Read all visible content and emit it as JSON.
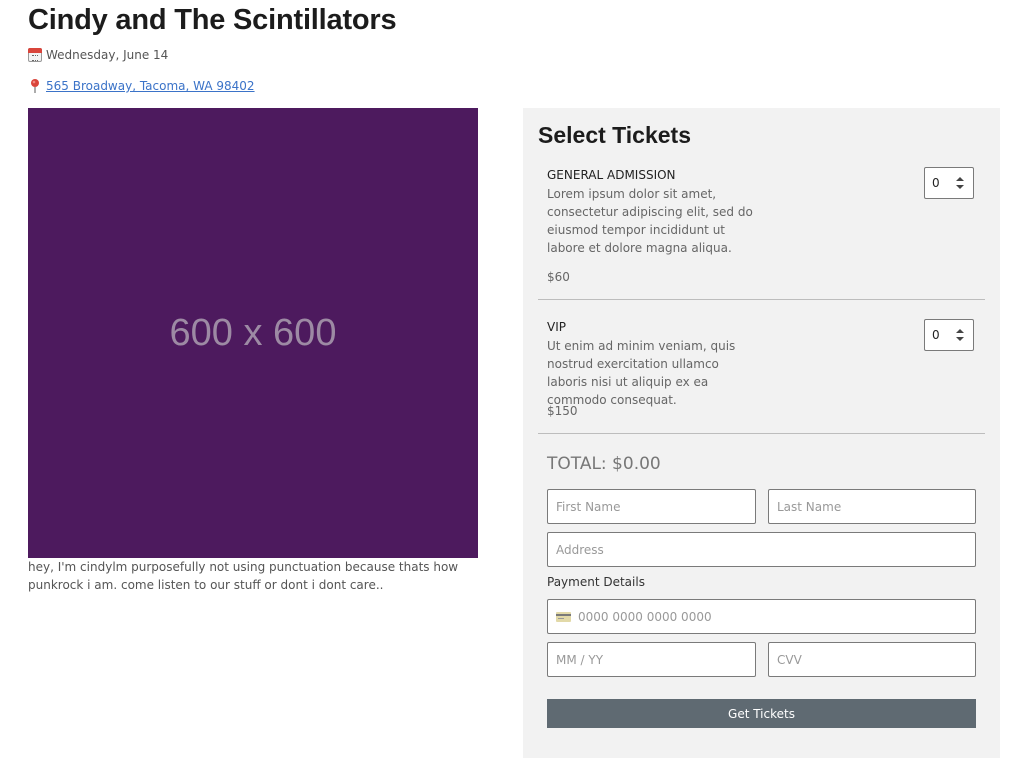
{
  "event": {
    "title": "Cindy and The Scintillators",
    "date": "Wednesday, June 14",
    "address": "565 Broadway, Tacoma, WA 98402",
    "image_label": "600 x 600",
    "image_color": "#4d1a5e",
    "description": "hey, I'm cindylm purposefully not using punctuation because thats how punkrock i am. come listen to our stuff or dont i dont care..",
    "date_icon": "calendar-icon",
    "address_icon": "map-pin-icon"
  },
  "tickets_panel": {
    "title": "Select Tickets",
    "tickets": [
      {
        "name": "GENERAL ADMISSION",
        "description": "Lorem ipsum dolor sit amet, consectetur adipiscing elit, sed do eiusmod tempor incididunt ut labore et dolore magna aliqua.",
        "price": "$60",
        "quantity": "0"
      },
      {
        "name": "VIP",
        "description": "Ut enim ad minim veniam, quis nostrud exercitation ullamco laboris nisi ut aliquip ex ea commodo consequat.",
        "price": "$150",
        "quantity": "0"
      }
    ],
    "total": "TOTAL: $0.00"
  },
  "form": {
    "first_name": {
      "value": "",
      "placeholder": "First Name"
    },
    "last_name": {
      "value": "",
      "placeholder": "Last Name"
    },
    "address": {
      "value": "",
      "placeholder": "Address"
    },
    "payment_label": "Payment Details",
    "card_number": {
      "value": "",
      "placeholder": "0000 0000 0000 0000",
      "icon": "credit-card-icon"
    },
    "expiry": {
      "value": "",
      "placeholder": "MM / YY"
    },
    "cvv": {
      "value": "",
      "placeholder": "CVV"
    },
    "submit_label": "Get Tickets"
  },
  "colors": {
    "link": "#3b73c8",
    "panel_bg": "#f2f2f2",
    "button_bg": "#5f6a72"
  }
}
